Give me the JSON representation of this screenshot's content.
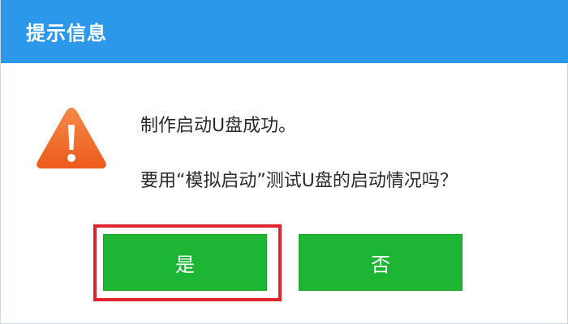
{
  "dialog": {
    "title": "提示信息",
    "icon": "warning-triangle-icon",
    "message_line_1": "制作启动U盘成功。",
    "message_line_2": "要用“模拟启动”测试U盘的启动情况吗？",
    "buttons": {
      "yes_label": "是",
      "no_label": "否"
    },
    "colors": {
      "title_bar": "#2b98ea",
      "button": "#1db634",
      "highlight": "#e0242d",
      "warning_icon": "#f06a2a"
    }
  }
}
